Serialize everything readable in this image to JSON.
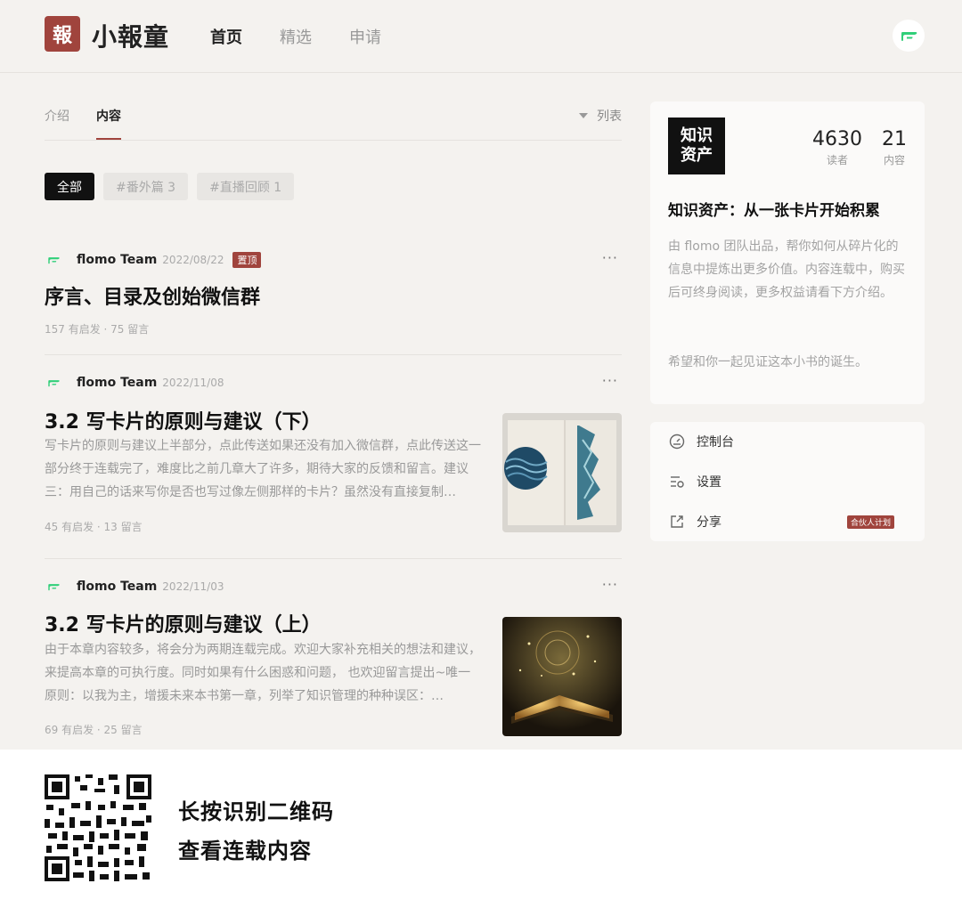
{
  "header": {
    "logo_char": "報",
    "brand": "小報童",
    "nav": [
      {
        "label": "首页",
        "active": true
      },
      {
        "label": "精选",
        "active": false
      },
      {
        "label": "申请",
        "active": false
      }
    ],
    "avatar_icon": "flomo-icon"
  },
  "tabs": {
    "items": [
      {
        "label": "介绍",
        "active": false
      },
      {
        "label": "内容",
        "active": true
      }
    ],
    "view_label": "列表"
  },
  "filters": [
    {
      "label": "全部",
      "active": true
    },
    {
      "label": "#番外篇 3",
      "active": false
    },
    {
      "label": "#直播回顾 1",
      "active": false
    }
  ],
  "posts": [
    {
      "author": "flomo Team",
      "date": "2022/08/22",
      "pin": "置顶",
      "more": "···",
      "title": "序言、目录及创始微信群",
      "body": "",
      "stats": "157 有启发 · 75 留言"
    },
    {
      "author": "flomo Team",
      "date": "2022/11/08",
      "more": "···",
      "title": "3.2 写卡片的原则与建议（下）",
      "body": "写卡片的原则与建议上半部分，点此传送如果还没有加入微信群，点此传送这一部分终于连载完了，难度比之前几章大了许多，期待大家的反馈和留言。建议三：用自己的话来写你是否也写过像左侧那样的卡片？虽然没有直接复制…",
      "stats": "45 有启发 · 13 留言",
      "thumb": "ocean-book-image"
    },
    {
      "author": "flomo Team",
      "date": "2022/11/03",
      "more": "···",
      "title": "3.2 写卡片的原则与建议（上）",
      "body": "由于本章内容较多，将会分为两期连载完成。欢迎大家补充相关的想法和建议，来提高本章的可执行度。同时如果有什么困惑和问题， 也欢迎留言提出~唯一原则：以我为主，增援未来本书第一章，列举了知识管理的种种误区：…",
      "stats": "69 有启发 · 25 留言",
      "thumb": "glowing-book-image"
    }
  ],
  "sidebar": {
    "cover_text": "知识资产",
    "readers": "4630",
    "readers_label": "读者",
    "contents": "21",
    "contents_label": "内容",
    "title": "知识资产：从一张卡片开始积累",
    "desc": "由 flomo 团队出品，帮你如何从碎片化的信息中提炼出更多价值。内容连载中，购买后可终身阅读，更多权益请看下方介绍。",
    "desc2": "希望和你一起见证这本小书的诞生。",
    "menu": [
      {
        "label": "控制台",
        "icon": "dashboard-icon"
      },
      {
        "label": "设置",
        "icon": "settings-icon"
      },
      {
        "label": "分享",
        "icon": "share-icon",
        "badge": "合伙人计划"
      }
    ]
  },
  "qr": {
    "line1": "长按识别二维码",
    "line2": "查看连载内容"
  },
  "colors": {
    "brand": "#a0443d",
    "flomo_green": "#30cf79",
    "background": "#f4f2ef"
  }
}
